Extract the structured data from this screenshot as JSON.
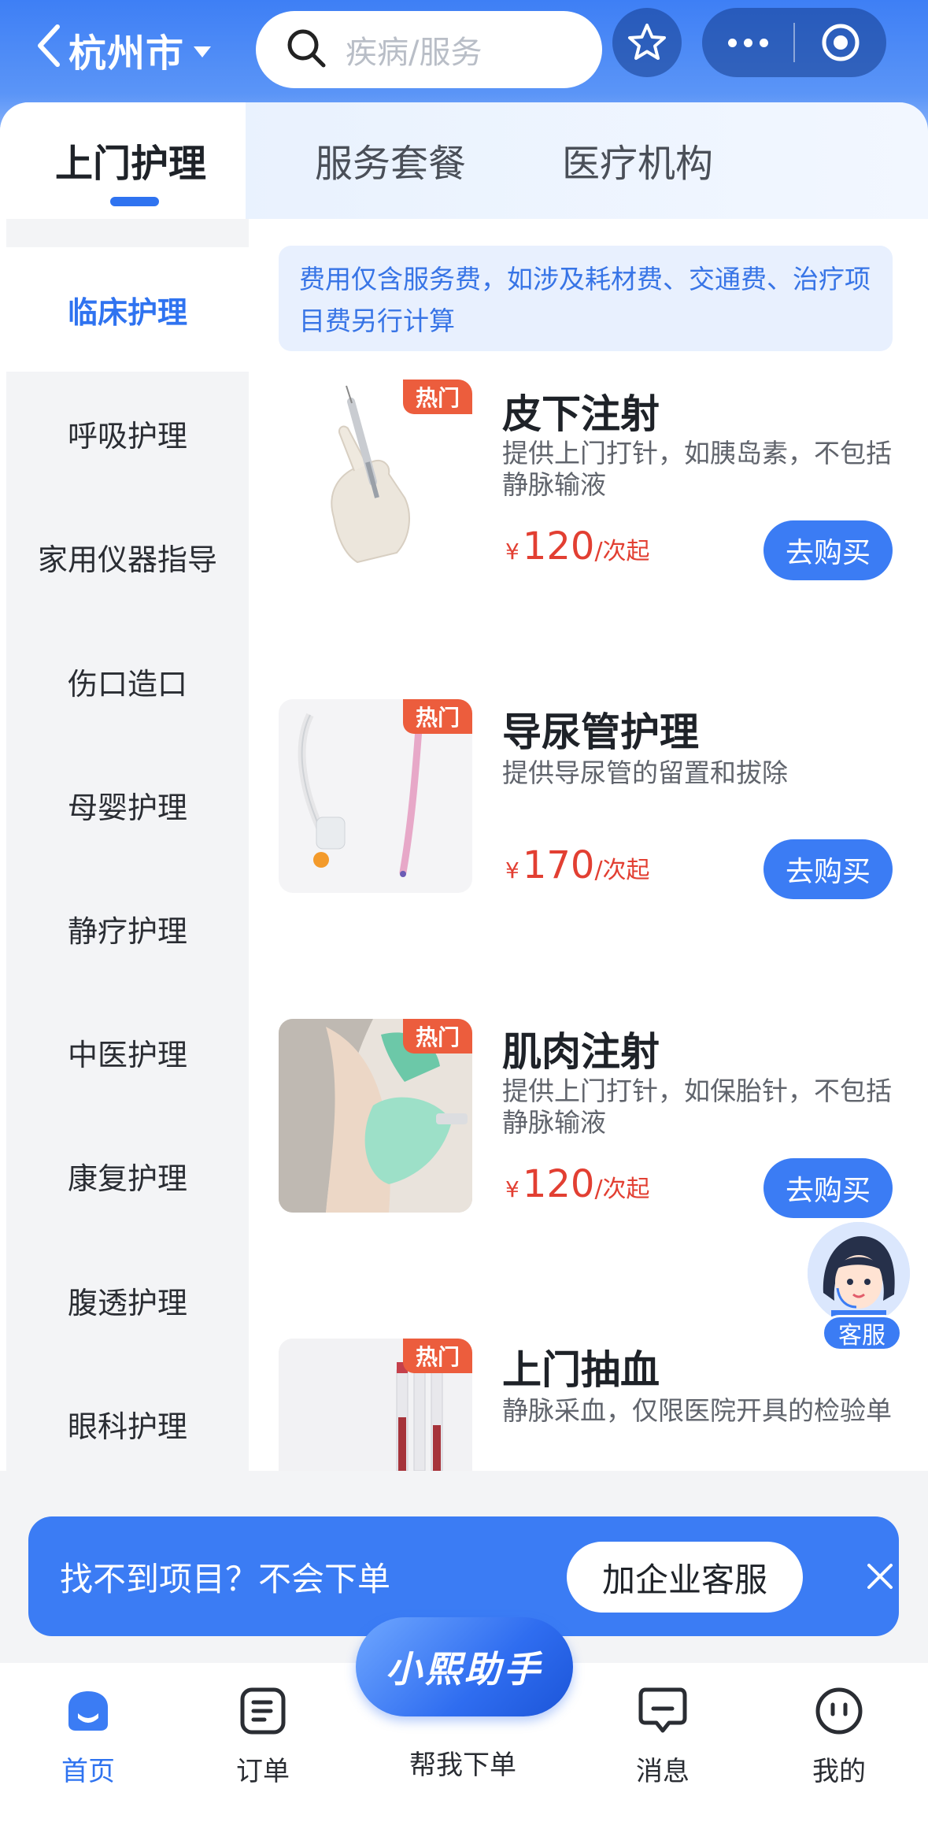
{
  "header": {
    "city": "杭州市",
    "search_placeholder": "疾病/服务"
  },
  "tabs": [
    {
      "label": "上门护理",
      "active": true
    },
    {
      "label": "服务套餐",
      "active": false
    },
    {
      "label": "医疗机构",
      "active": false
    }
  ],
  "sidebar": {
    "items": [
      {
        "label": "临床护理",
        "active": true
      },
      {
        "label": "呼吸护理"
      },
      {
        "label": "家用仪器指导"
      },
      {
        "label": "伤口造口"
      },
      {
        "label": "母婴护理"
      },
      {
        "label": "静疗护理"
      },
      {
        "label": "中医护理"
      },
      {
        "label": "康复护理"
      },
      {
        "label": "腹透护理"
      },
      {
        "label": "眼科护理"
      }
    ]
  },
  "notice": "费用仅含服务费，如涉及耗材费、交通费、治疗项目费另行计算",
  "services": [
    {
      "title": "皮下注射",
      "desc": "提供上门打针，如胰岛素，不包括静脉输液",
      "badge": "热门",
      "currency": "¥",
      "price": "120",
      "unit": "/次起",
      "button": "去购买"
    },
    {
      "title": "导尿管护理",
      "desc": "提供导尿管的留置和拔除",
      "badge": "热门",
      "currency": "¥",
      "price": "170",
      "unit": "/次起",
      "button": "去购买"
    },
    {
      "title": "肌肉注射",
      "desc": "提供上门打针，如保胎针，不包括静脉输液",
      "badge": "热门",
      "currency": "¥",
      "price": "120",
      "unit": "/次起",
      "button": "去购买"
    },
    {
      "title": "上门抽血",
      "desc": "静脉采血，仅限医院开具的检验单",
      "badge": "热门"
    }
  ],
  "customer_service": "客服",
  "banner": {
    "text": "找不到项目？不会下单",
    "button": "加企业客服"
  },
  "tabbar": {
    "items": [
      {
        "label": "首页",
        "icon": "home-icon",
        "active": true
      },
      {
        "label": "订单",
        "icon": "order-icon"
      },
      {
        "label": "帮我下单",
        "icon": "assistant-icon"
      },
      {
        "label": "消息",
        "icon": "message-icon"
      },
      {
        "label": "我的",
        "icon": "profile-icon"
      }
    ],
    "assistant_label": "小熙助手"
  },
  "colors": {
    "primary": "#3b7cf4",
    "price": "#e23f32",
    "hot_badge": "#ec5d3d"
  }
}
